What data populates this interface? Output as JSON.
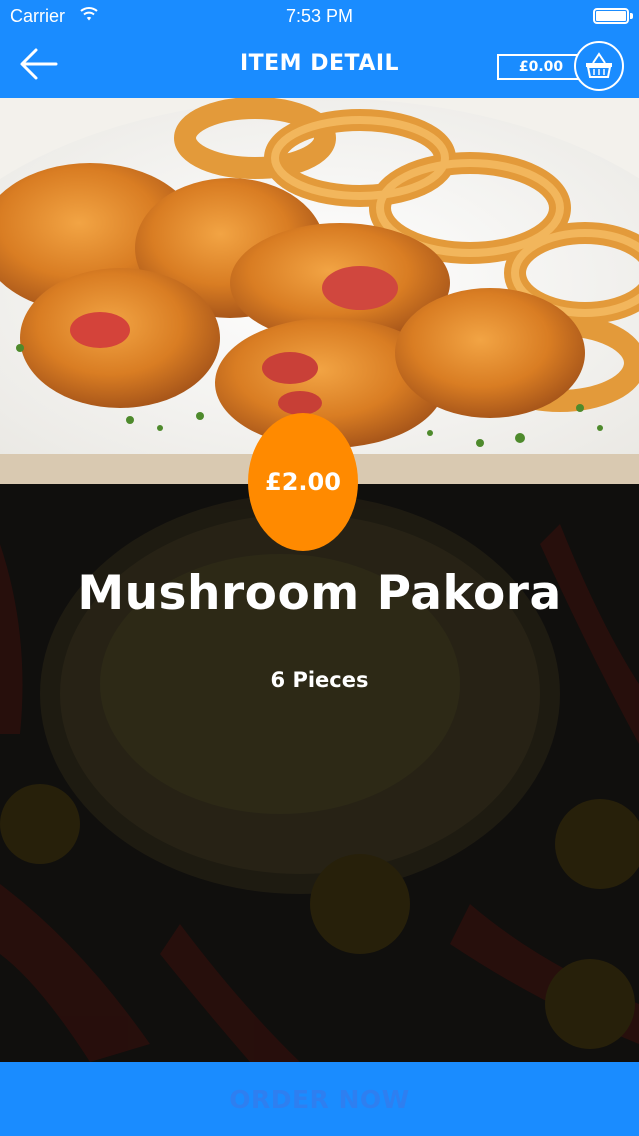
{
  "status_bar": {
    "carrier": "Carrier",
    "time": "7:53 PM"
  },
  "nav": {
    "title": "ITEM DETAIL",
    "cart_total": "£0.00",
    "back_icon": "arrow-left-icon",
    "cart_icon": "basket-icon"
  },
  "item": {
    "price": "£2.00",
    "name": "Mushroom Pakora",
    "description": "6 Pieces"
  },
  "actions": {
    "order_label": "ORDER NOW"
  },
  "colors": {
    "primary": "#1a8cff",
    "price_badge": "#ff8a00",
    "order_text": "#2e7ff0"
  }
}
